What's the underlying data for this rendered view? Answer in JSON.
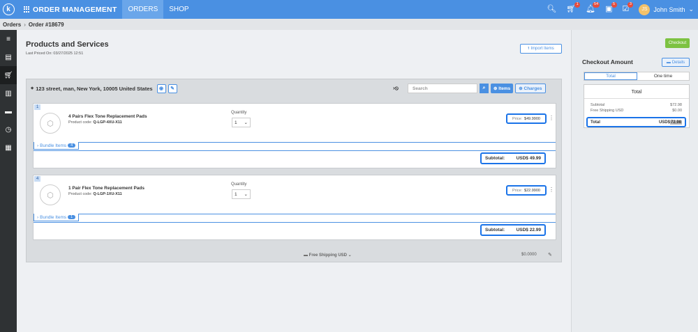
{
  "topbar": {
    "logo_letter": "k",
    "app_name": "ORDER MANAGEMENT",
    "tabs": [
      "ORDERS",
      "SHOP"
    ],
    "cart_badge": "1",
    "bell_badge": "54",
    "cal_badge": "5",
    "check_badge": "3",
    "avatar_initials": "JS",
    "user_name": "John Smith"
  },
  "breadcrumb": {
    "root": "Orders",
    "current": "Order #18679"
  },
  "page": {
    "title": "Products and Services",
    "last_priced": "Last Priced On: 03/27/2025 12:51",
    "import_label": "Import Items"
  },
  "address": {
    "text": "123 street, man, New York, 10005 United States"
  },
  "search": {
    "placeholder": "Search"
  },
  "buttons": {
    "items": "Items",
    "charges": "Charges"
  },
  "line_items": [
    {
      "qty_no": "1",
      "name": "4 Pairs Flex Tone Replacement Pads",
      "code_label": "Product code:",
      "code": "Q-LGP-4XU-X11",
      "quantity_label": "Quantity",
      "quantity": "1",
      "price_label": "Price:",
      "price": "$49.9900",
      "bundle_label": "Bundle Items",
      "bundle_count": "4",
      "subtotal_label": "Subtotal:",
      "subtotal": "USD$ 49.99"
    },
    {
      "qty_no": "4",
      "name": "1 Pair Flex Tone Replacement Pads",
      "code_label": "Product code:",
      "code": "Q-LGP-1XU-X11",
      "quantity_label": "Quantity",
      "quantity": "1",
      "price_label": "Price:",
      "price": "$22.9900",
      "bundle_label": "Bundle Items",
      "bundle_count": "1",
      "subtotal_label": "Subtotal:",
      "subtotal": "USD$ 22.99"
    }
  ],
  "shipping": {
    "label": "Free Shipping USD",
    "amount": "$0.0000"
  },
  "checkout": {
    "button": "Checkout",
    "title": "Checkout Amount",
    "details": "Details",
    "tabs": [
      "Total",
      "One time"
    ],
    "box_title": "Total",
    "subtotal_label": "Subtotal",
    "subtotal": "$72.98",
    "shipping_label": "Free Shipping USD",
    "shipping": "$0.00",
    "total_label": "Total",
    "total_prefix": "USD$",
    "total_value": "72.98"
  }
}
